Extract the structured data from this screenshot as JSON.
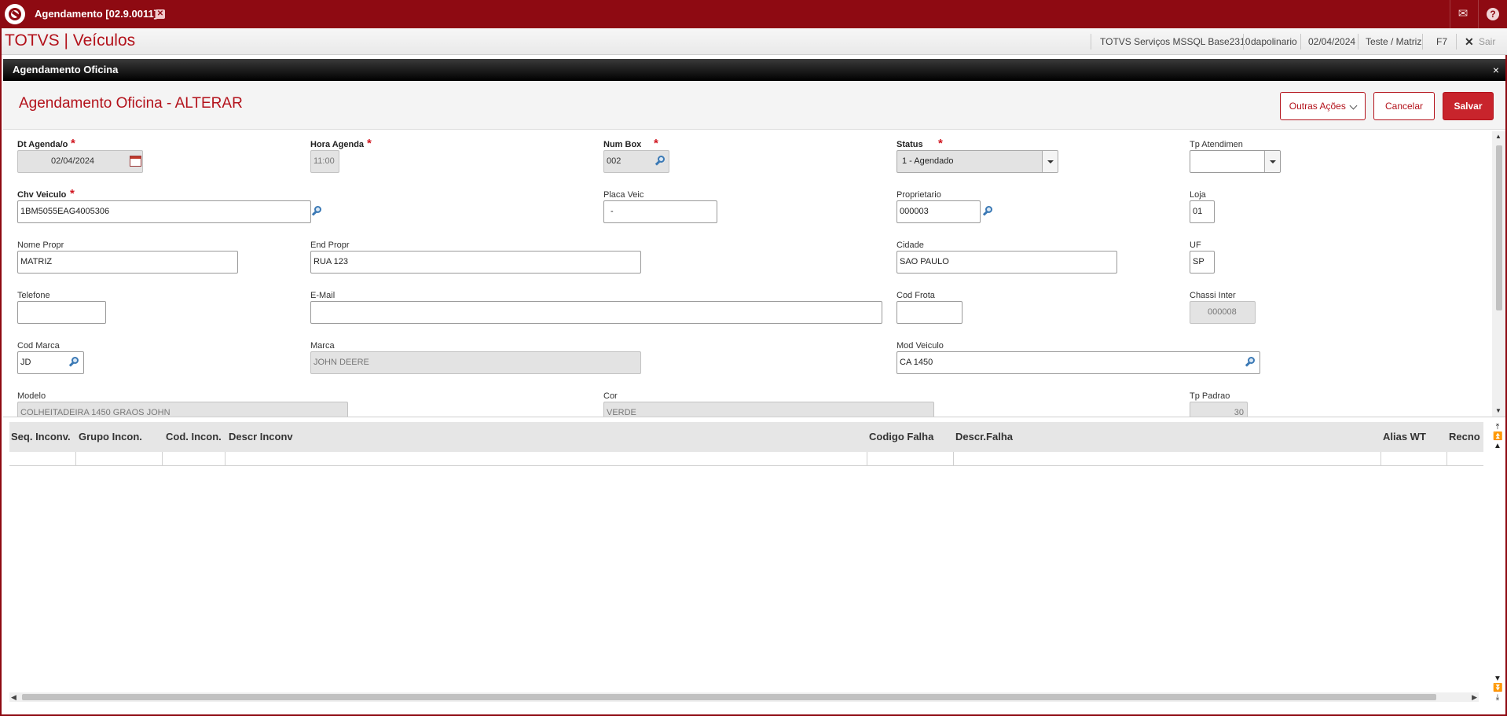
{
  "topbar": {
    "tab_title": "Agendamento [02.9.0011]",
    "tab_close": "✕",
    "mail_icon": "mail-icon",
    "help_icon": "help-icon"
  },
  "subbar": {
    "product": "TOTVS | Veículos",
    "environment": "TOTVS Serviços MSSQL Base2310",
    "user": "dapolinario",
    "date": "02/04/2024",
    "branch": "Teste / Matriz",
    "shortcut": "F7",
    "logout": "Sair"
  },
  "dialog": {
    "title": "Agendamento Oficina",
    "close": "×"
  },
  "form": {
    "title": "Agendamento Oficina - ALTERAR",
    "buttons": {
      "other_actions": "Outras Ações",
      "cancel": "Cancelar",
      "save": "Salvar"
    },
    "fields": {
      "dt_agenda": {
        "label": "Dt Agenda/o",
        "value": "02/04/2024"
      },
      "hora_agenda": {
        "label": "Hora Agenda",
        "value": "11:00"
      },
      "num_box": {
        "label": "Num Box",
        "value": "002"
      },
      "status": {
        "label": "Status",
        "value": "1 - Agendado"
      },
      "tp_atendimen": {
        "label": "Tp Atendimen",
        "value": ""
      },
      "chv_veiculo": {
        "label": "Chv Veiculo",
        "value": "1BM5055EAG4005306"
      },
      "placa_veic": {
        "label": "Placa Veic",
        "value": " - "
      },
      "proprietario": {
        "label": "Proprietario",
        "value": "000003"
      },
      "loja": {
        "label": "Loja",
        "value": "01"
      },
      "nome_propr": {
        "label": "Nome Propr",
        "value": "MATRIZ"
      },
      "end_propr": {
        "label": "End Propr",
        "value": "RUA 123"
      },
      "cidade": {
        "label": "Cidade",
        "value": "SAO PAULO"
      },
      "uf": {
        "label": "UF",
        "value": "SP"
      },
      "telefone": {
        "label": "Telefone",
        "value": ""
      },
      "email": {
        "label": "E-Mail",
        "value": ""
      },
      "cod_frota": {
        "label": "Cod Frota",
        "value": ""
      },
      "chassi_inter": {
        "label": "Chassi Inter",
        "value": "000008"
      },
      "cod_marca": {
        "label": "Cod Marca",
        "value": "JD"
      },
      "marca": {
        "label": "Marca",
        "value": "JOHN DEERE"
      },
      "mod_veiculo": {
        "label": "Mod Veiculo",
        "value": "CA 1450"
      },
      "modelo": {
        "label": "Modelo",
        "value": "COLHEITADEIRA 1450 GRAOS  JOHN"
      },
      "cor": {
        "label": "Cor",
        "value": "VERDE"
      },
      "tp_padrao": {
        "label": "Tp Padrao",
        "value": "30"
      }
    }
  },
  "grid": {
    "columns": [
      "Seq. Inconv.",
      "Grupo Incon.",
      "Cod. Incon.",
      "Descr Inconv",
      "Codigo Falha",
      "Descr.Falha",
      "Alias WT",
      "Recno"
    ]
  }
}
